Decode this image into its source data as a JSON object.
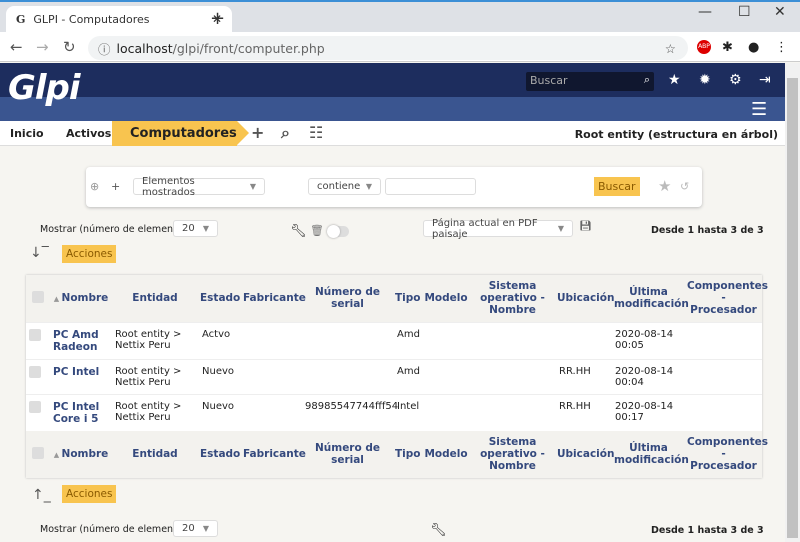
{
  "browser": {
    "tab_title": "GLPI - Computadores",
    "url_host": "localhost",
    "url_path": "/glpi/front/computer.php"
  },
  "header": {
    "logo": "Glpi",
    "search_placeholder": "Buscar"
  },
  "breadcrumb": [
    "Inicio",
    "Activos",
    "Computadores"
  ],
  "entity": "Root entity (estructura en árbol)",
  "search": {
    "criteria_field": "Elementos mostrados",
    "operator": "contiene",
    "value": "",
    "button": "Buscar"
  },
  "list_controls": {
    "show_label": "Mostrar (número de elementos)",
    "per_page": "20",
    "export": "Página actual en PDF paisaje",
    "pager": "Desde 1 hasta 3 de 3",
    "actions": "Acciones"
  },
  "table": {
    "columns": [
      "Nombre",
      "Entidad",
      "Estado",
      "Fabricante",
      "Número de serial",
      "Tipo",
      "Modelo",
      "Sistema operativo - Nombre",
      "Ubicación",
      "Última modificación",
      "Componentes - Procesador"
    ],
    "rows": [
      [
        "PC Amd Radeon",
        "Root entity > Nettix Peru",
        "Actvo",
        "",
        "",
        "Amd",
        "",
        "",
        "",
        "2020-08-14 00:05",
        ""
      ],
      [
        "PC Intel",
        "Root entity > Nettix Peru",
        "Nuevo",
        "",
        "",
        "Amd",
        "",
        "",
        "RR.HH",
        "2020-08-14 00:04",
        ""
      ],
      [
        "PC Intel Core i 5",
        "Root entity > Nettix Peru",
        "Nuevo",
        "",
        "98985547744fff54",
        "Intel",
        "",
        "",
        "RR.HH",
        "2020-08-14 00:17",
        ""
      ]
    ]
  },
  "colors": {
    "header_dark": "#1d2d5e",
    "header_light": "#3a5590",
    "accent": "#f8c44f"
  }
}
